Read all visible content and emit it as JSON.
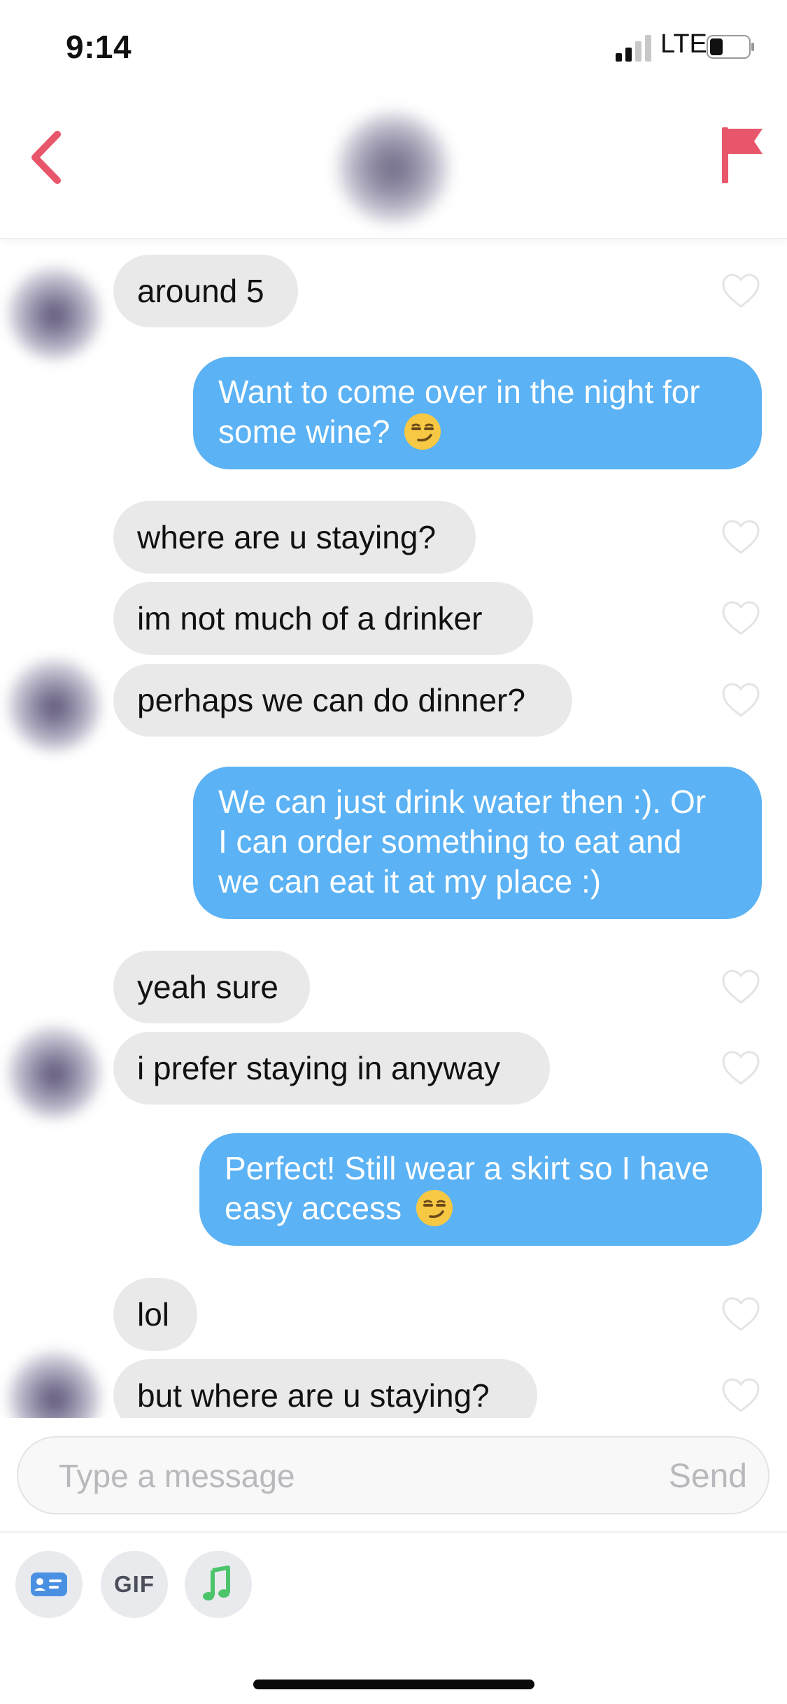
{
  "status_bar": {
    "time": "9:14",
    "network": "LTE",
    "signal_bars": 2,
    "battery_level": 0.3
  },
  "header": {
    "back_icon": "chevron-left-icon",
    "flag_icon": "flag-icon",
    "accent_color": "#e8566c"
  },
  "messages": [
    {
      "side": "in",
      "text": "around 5"
    },
    {
      "side": "out",
      "lines": [
        "Want to come over in the night for",
        "some wine?"
      ],
      "emoji": "smirk"
    },
    {
      "side": "in",
      "text": "where are u staying?"
    },
    {
      "side": "in",
      "text": "im not much of a drinker"
    },
    {
      "side": "in",
      "text": "perhaps we can do dinner?"
    },
    {
      "side": "out",
      "lines": [
        "We can just drink water then :). Or",
        "I can order something to eat and",
        "we can eat it at my place :)"
      ]
    },
    {
      "side": "in",
      "text": "yeah sure"
    },
    {
      "side": "in",
      "text": "i prefer staying in anyway"
    },
    {
      "side": "out",
      "lines": [
        "Perfect! Still wear a skirt so I have",
        "easy access"
      ],
      "emoji": "smirk"
    },
    {
      "side": "in",
      "text": "lol"
    },
    {
      "side": "in",
      "text": "but where are u staying?"
    }
  ],
  "composer": {
    "placeholder": "Type a message",
    "send_label": "Send"
  },
  "toolbar": {
    "gif_label": "GIF",
    "icons": [
      "contact-card-icon",
      "gif-icon",
      "music-note-icon"
    ]
  },
  "colors": {
    "outgoing_bubble": "#5bb2f4",
    "incoming_bubble": "#e9e9ea",
    "music_icon": "#4cc46b",
    "contact_icon": "#4a90e2"
  }
}
